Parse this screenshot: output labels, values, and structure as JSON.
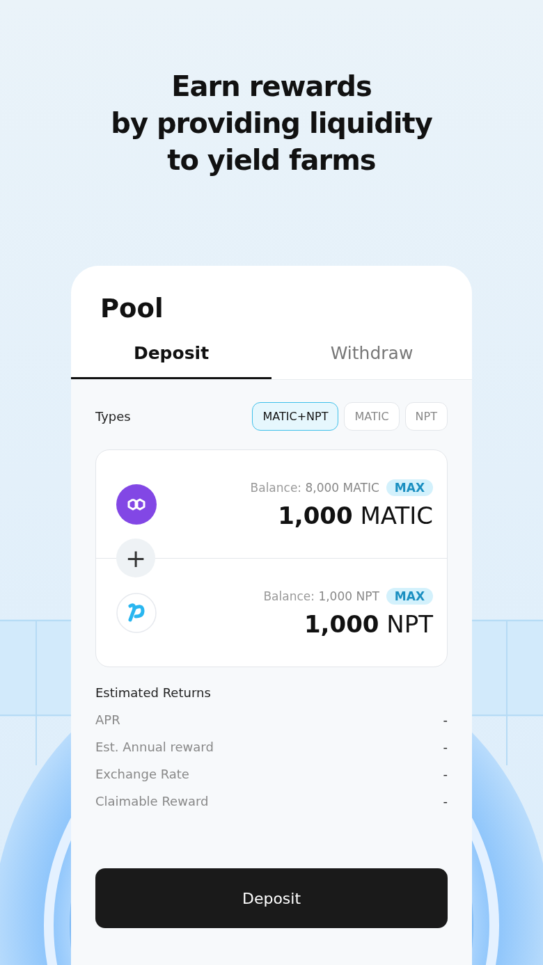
{
  "headline": [
    "Earn rewards",
    "by providing liquidity",
    "to yield farms"
  ],
  "pool": {
    "title": "Pool",
    "tabs": [
      {
        "label": "Deposit",
        "selected": true
      },
      {
        "label": "Withdraw",
        "selected": false
      }
    ],
    "types_label": "Types",
    "types": [
      {
        "label": "MATIC+NPT",
        "selected": true
      },
      {
        "label": "MATIC",
        "selected": false
      },
      {
        "label": "NPT",
        "selected": false
      }
    ],
    "tokens": [
      {
        "kind": "polygon",
        "balance_label": "Balance:",
        "balance": "8,000 MATIC",
        "max": "MAX",
        "amount": "**1,000** MATIC"
      },
      {
        "kind": "npt",
        "balance_label": "Balance:",
        "balance": "1,000 NPT",
        "max": "MAX",
        "amount": "**1,000** NPT"
      }
    ],
    "plus": "+",
    "returns_title": "Estimated Returns",
    "returns": [
      {
        "label": "APR",
        "value": "-"
      },
      {
        "label": "Est. Annual reward",
        "value": "-"
      },
      {
        "label": "Exchange Rate",
        "value": "-"
      },
      {
        "label": "Claimable Reward",
        "value": "-"
      }
    ],
    "action": "Deposit"
  }
}
